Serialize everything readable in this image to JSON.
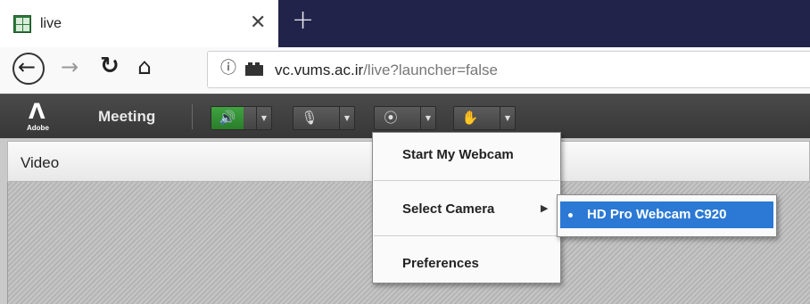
{
  "browser": {
    "tab": {
      "title": "live",
      "close_icon": "close-icon"
    },
    "new_tab_icon": "plus-icon",
    "address": {
      "domain": "vc.vums.ac.ir",
      "path": "/live?launcher=false"
    }
  },
  "app": {
    "logo_text": "Adobe",
    "menu": {
      "meeting_label": "Meeting"
    },
    "toolbar": {
      "audio": {
        "icon": "speaker-icon",
        "active": true,
        "color": "#3fa33f"
      },
      "mic": {
        "icon": "microphone-icon"
      },
      "webcam": {
        "icon": "webcam-icon"
      },
      "status": {
        "icon": "raise-hand-icon"
      }
    }
  },
  "pod": {
    "title": "Video"
  },
  "camera_menu": {
    "items": [
      {
        "label": "Start My Webcam"
      },
      {
        "label": "Select Camera",
        "has_submenu": true
      },
      {
        "label": "Preferences"
      }
    ],
    "submenu": {
      "cameras": [
        {
          "label": "HD Pro Webcam C920",
          "selected": true
        }
      ],
      "highlight_color": "#2b79d4"
    }
  }
}
